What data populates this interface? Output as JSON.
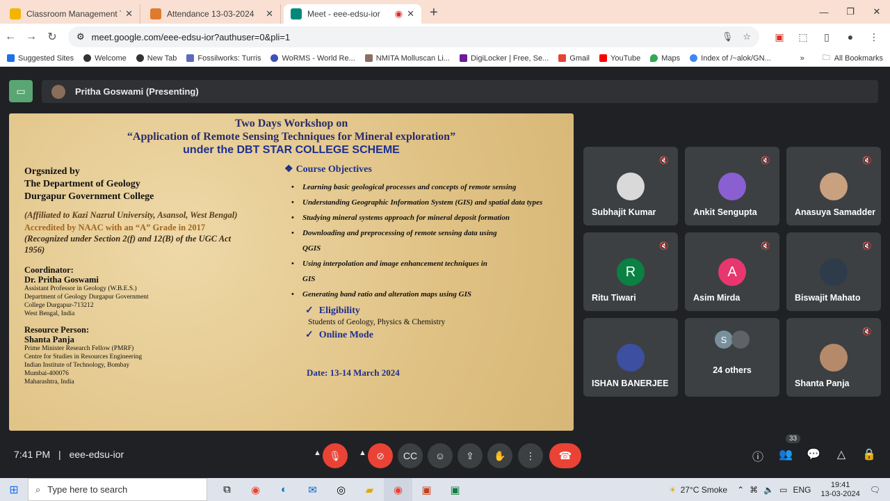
{
  "browser": {
    "tabs": [
      {
        "title": "Classroom Management Tools",
        "color": "#f4b400"
      },
      {
        "title": "Attendance 13-03-2024",
        "color": "#e07a2f"
      },
      {
        "title": "Meet - eee-edsu-ior",
        "color": "#00897b"
      }
    ],
    "url": "meet.google.com/eee-edsu-ior?authuser=0&pli=1",
    "bookmarks": [
      "Suggested Sites",
      "Welcome",
      "New Tab",
      "Fossilworks: Turris",
      "WoRMS - World Re...",
      "NMITA Molluscan Li...",
      "DigiLocker | Free, Se...",
      "Gmail",
      "YouTube",
      "Maps",
      "Index of /~alok/GN..."
    ],
    "all_bookmarks": "All Bookmarks"
  },
  "meet": {
    "presenter": "Pritha Goswami (Presenting)",
    "time": "7:41 PM",
    "separator": "|",
    "code": "eee-edsu-ior",
    "participants_count": "33",
    "others_initial": "S",
    "participants": [
      {
        "name": "Subhajit Kumar",
        "initial": "",
        "color": "#d9d9d9"
      },
      {
        "name": "Ankit Sengupta",
        "initial": "",
        "color": "#8a5fd1"
      },
      {
        "name": "Anasuya Samadder",
        "initial": "",
        "color": "#c9a17f"
      },
      {
        "name": "Ritu Tiwari",
        "initial": "R",
        "color": "#0b8043"
      },
      {
        "name": "Asim Mirda",
        "initial": "A",
        "color": "#e8366e"
      },
      {
        "name": "Biswajit Mahato",
        "initial": "",
        "color": "#2d3b4a"
      },
      {
        "name": "ISHAN BANERJEE",
        "initial": "",
        "color": "#3d4fa0"
      },
      {
        "name": "24 others",
        "initial": "",
        "color": "#5f6368"
      },
      {
        "name": "Shanta Panja",
        "initial": "",
        "color": "#b58a6a"
      }
    ]
  },
  "slide": {
    "title1": "Two Days Workshop on",
    "title2": "“Application of Remote Sensing Techniques for Mineral exploration”",
    "title3": "under the DBT STAR COLLEGE SCHEME",
    "org1": "Orgsnized by",
    "org2": "The Department of Geology",
    "org3": "Durgapur Government College",
    "aff": "(Affiliated to Kazi Nazrul University, Asansol, West Bengal)",
    "naac": "Accredited by NAAC with an “A” Grade in 2017",
    "rec": "(Recognized under Section 2(f) and 12(B) of the UGC Act 1956)",
    "coord_h": "Coordinator:",
    "coord_name": "Dr. Pritha Goswami",
    "coord_l1": "Assistant Professor in Geology (W.B.E.S.)",
    "coord_l2": "Department of Geology Durgapur Government",
    "coord_l3": "College Durgapur-713212",
    "coord_l4": "West Bengal, India",
    "rp_h": "Resource Person:",
    "rp_name": "Shanta Panja",
    "rp_l1": "Prime Minister Research Fellow (PMRF)",
    "rp_l2": "Centre for Studies in Resources Engineering",
    "rp_l3": "Indian Institute of Technology, Bombay",
    "rp_l4": "Mumbai-400076",
    "rp_l5": "Maharashtra, India",
    "course_h": "Course Objectives",
    "obj1": "Learning basic geological processes and concepts of remote sensing",
    "obj2": "Understanding Geographic Information System (GIS) and spatial data types",
    "obj3": "Studying mineral systems approach for mineral deposit formation",
    "obj4a": "Downloading and preprocessing of remote sensing data using",
    "obj4b": "QGIS",
    "obj5a": "Using interpolation and image enhancement techniques in",
    "obj5b": "GIS",
    "obj6": "Generating band ratio and alteration maps using GIS",
    "elig_h": "Eligibility",
    "elig": "Students of Geology, Physics & Chemistry",
    "mode": "Online Mode",
    "date": "Date: 13-14 March 2024"
  },
  "taskbar": {
    "search_placeholder": "Type here to search",
    "weather": "27°C  Smoke",
    "lang": "ENG",
    "time": "19:41",
    "date": "13-03-2024"
  }
}
